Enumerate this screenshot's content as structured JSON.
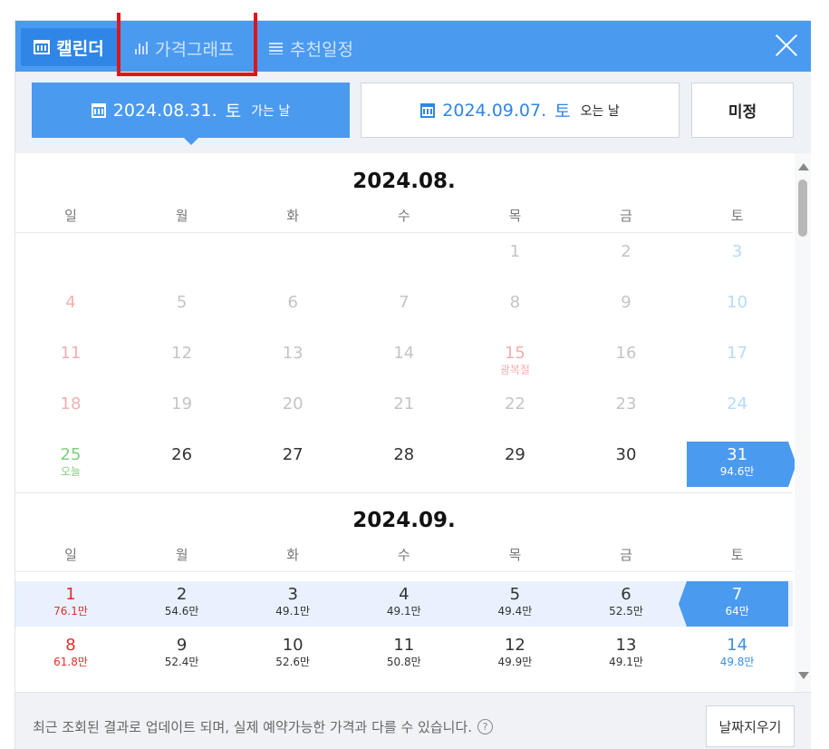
{
  "header": {
    "tabs": [
      {
        "label": "캘린더",
        "active": true,
        "icon": "calendar-icon"
      },
      {
        "label": "가격그래프",
        "active": false,
        "icon": "bar-chart-icon"
      },
      {
        "label": "추천일정",
        "active": false,
        "icon": "list-icon"
      }
    ],
    "close_icon": "close-icon"
  },
  "dates": {
    "depart": {
      "date": "2024.08.31.",
      "weekday": "토",
      "label": "가는 날"
    },
    "return": {
      "date": "2024.09.07.",
      "weekday": "토",
      "label": "오는 날"
    },
    "undecided": "미정"
  },
  "weekdays": [
    "일",
    "월",
    "화",
    "수",
    "목",
    "금",
    "토"
  ],
  "months": [
    {
      "title": "2024.08.",
      "days": [
        {
          "d": "1",
          "col": 4,
          "row": 0,
          "state": "past"
        },
        {
          "d": "2",
          "col": 5,
          "row": 0,
          "state": "past"
        },
        {
          "d": "3",
          "col": 6,
          "row": 0,
          "state": "past-sat"
        },
        {
          "d": "4",
          "col": 0,
          "row": 1,
          "state": "past-sun"
        },
        {
          "d": "5",
          "col": 1,
          "row": 1,
          "state": "past"
        },
        {
          "d": "6",
          "col": 2,
          "row": 1,
          "state": "past"
        },
        {
          "d": "7",
          "col": 3,
          "row": 1,
          "state": "past"
        },
        {
          "d": "8",
          "col": 4,
          "row": 1,
          "state": "past"
        },
        {
          "d": "9",
          "col": 5,
          "row": 1,
          "state": "past"
        },
        {
          "d": "10",
          "col": 6,
          "row": 1,
          "state": "past-sat"
        },
        {
          "d": "11",
          "col": 0,
          "row": 2,
          "state": "past-sun"
        },
        {
          "d": "12",
          "col": 1,
          "row": 2,
          "state": "past"
        },
        {
          "d": "13",
          "col": 2,
          "row": 2,
          "state": "past"
        },
        {
          "d": "14",
          "col": 3,
          "row": 2,
          "state": "past"
        },
        {
          "d": "15",
          "col": 4,
          "row": 2,
          "state": "past-hol",
          "sub": "광복절"
        },
        {
          "d": "16",
          "col": 5,
          "row": 2,
          "state": "past"
        },
        {
          "d": "17",
          "col": 6,
          "row": 2,
          "state": "past-sat"
        },
        {
          "d": "18",
          "col": 0,
          "row": 3,
          "state": "past-sun"
        },
        {
          "d": "19",
          "col": 1,
          "row": 3,
          "state": "past"
        },
        {
          "d": "20",
          "col": 2,
          "row": 3,
          "state": "past"
        },
        {
          "d": "21",
          "col": 3,
          "row": 3,
          "state": "past"
        },
        {
          "d": "22",
          "col": 4,
          "row": 3,
          "state": "past"
        },
        {
          "d": "23",
          "col": 5,
          "row": 3,
          "state": "past"
        },
        {
          "d": "24",
          "col": 6,
          "row": 3,
          "state": "past-sat"
        },
        {
          "d": "25",
          "col": 0,
          "row": 4,
          "state": "today",
          "sub": "오늘"
        },
        {
          "d": "26",
          "col": 1,
          "row": 4,
          "state": "normal"
        },
        {
          "d": "27",
          "col": 2,
          "row": 4,
          "state": "normal"
        },
        {
          "d": "28",
          "col": 3,
          "row": 4,
          "state": "normal"
        },
        {
          "d": "29",
          "col": 4,
          "row": 4,
          "state": "normal"
        },
        {
          "d": "30",
          "col": 5,
          "row": 4,
          "state": "normal"
        },
        {
          "d": "31",
          "col": 6,
          "row": 4,
          "state": "selected-start",
          "sub": "94.6만"
        }
      ]
    },
    {
      "title": "2024.09.",
      "days": [
        {
          "d": "1",
          "col": 0,
          "row": 0,
          "state": "sun",
          "sub": "76.1만"
        },
        {
          "d": "2",
          "col": 1,
          "row": 0,
          "state": "normal",
          "sub": "54.6만"
        },
        {
          "d": "3",
          "col": 2,
          "row": 0,
          "state": "normal",
          "sub": "49.1만"
        },
        {
          "d": "4",
          "col": 3,
          "row": 0,
          "state": "normal",
          "sub": "49.1만"
        },
        {
          "d": "5",
          "col": 4,
          "row": 0,
          "state": "normal",
          "sub": "49.4만"
        },
        {
          "d": "6",
          "col": 5,
          "row": 0,
          "state": "normal",
          "sub": "52.5만"
        },
        {
          "d": "7",
          "col": 6,
          "row": 0,
          "state": "selected-end",
          "sub": "64만"
        },
        {
          "d": "8",
          "col": 0,
          "row": 1,
          "state": "sun",
          "sub": "61.8만"
        },
        {
          "d": "9",
          "col": 1,
          "row": 1,
          "state": "normal",
          "sub": "52.4만"
        },
        {
          "d": "10",
          "col": 2,
          "row": 1,
          "state": "normal",
          "sub": "52.6만"
        },
        {
          "d": "11",
          "col": 3,
          "row": 1,
          "state": "normal",
          "sub": "50.8만"
        },
        {
          "d": "12",
          "col": 4,
          "row": 1,
          "state": "normal",
          "sub": "49.9만"
        },
        {
          "d": "13",
          "col": 5,
          "row": 1,
          "state": "normal",
          "sub": "49.1만"
        },
        {
          "d": "14",
          "col": 6,
          "row": 1,
          "state": "sat",
          "sub": "49.8만"
        }
      ]
    }
  ],
  "footer": {
    "notice": "최근 조회된 결과로 업데이트 되며, 실제 예약가능한 가격과 다를 수 있습니다.",
    "help_icon": "?",
    "clear_button": "날짜지우기"
  },
  "colors": {
    "accent": "#4a9af0",
    "highlight": "#e0141b",
    "sunday": "#e0302c",
    "saturday": "#3a8fe8",
    "today": "#7dd07f"
  }
}
